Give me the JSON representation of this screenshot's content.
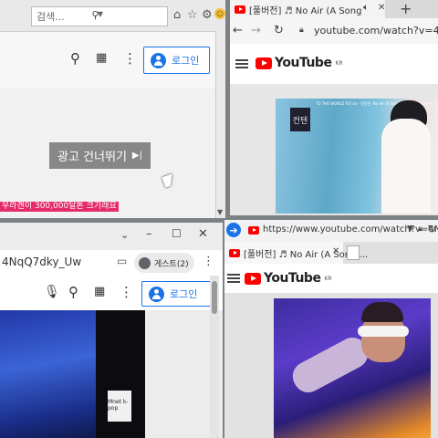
{
  "top_left": {
    "search_placeholder": "검색...",
    "signin_label": "로그인",
    "skip_ad_label": "광고 건너뛰기",
    "promo_text": "우라겐이 300,000달톤 크기래요"
  },
  "top_right": {
    "tab_title": "[풀버전] ♬ No Air (A Song",
    "url": "youtube.com/watch?v=4Nq",
    "logo_text": "YouTube",
    "logo_region": "KR",
    "video_caption": "TO THE WORLD FLY on · 단장전 ·No Air (A Song of Ice and Fire)•",
    "video_badge": "컨텐"
  },
  "bottom_left": {
    "address_text": "4NqQ7dky_Uw",
    "guest_label": "게스트(2)",
    "signin_label": "로그인",
    "video_logo": "Mnet k-pop"
  },
  "bottom_right": {
    "url": "https://www.youtube.com/watch?v=4N",
    "tab_title": "[풀버전] ♬ No Air (A Song ...",
    "logo_text": "YouTube",
    "logo_region": "KR"
  },
  "colors": {
    "youtube_red": "#ff0000",
    "link_blue": "#1a73e8",
    "promo_pink": "#e62b6a"
  }
}
